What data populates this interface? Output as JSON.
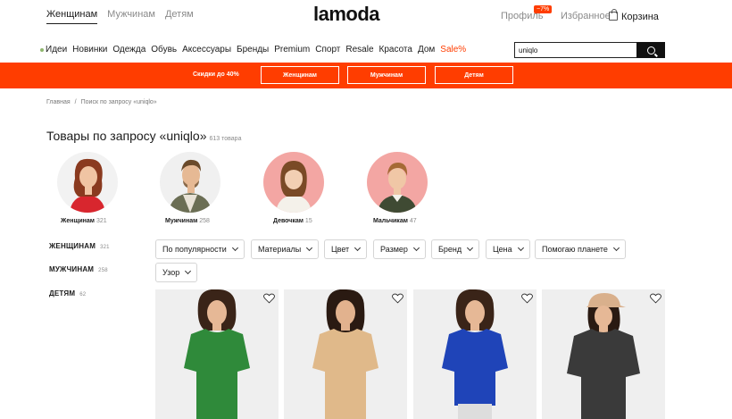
{
  "header": {
    "gender_tabs": [
      "Женщинам",
      "Мужчинам",
      "Детям"
    ],
    "logo": "lamoda",
    "profile": "Профиль",
    "profile_badge": "−7%",
    "favorites": "Избранное",
    "cart": "Корзина"
  },
  "nav": {
    "items": [
      "Идеи",
      "Новинки",
      "Одежда",
      "Обувь",
      "Аксессуары",
      "Бренды",
      "Premium",
      "Спорт",
      "Resale",
      "Красота",
      "Дом",
      "Sale%"
    ]
  },
  "search": {
    "value": "uniqlo",
    "icon": "search-icon"
  },
  "promo": {
    "text": "Скидки до 40%",
    "buttons": [
      "Женщинам",
      "Мужчинам",
      "Детям"
    ],
    "color": "#ff3d00"
  },
  "breadcrumb": [
    "Главная",
    "Поиск по запросу «uniqlo»"
  ],
  "page": {
    "title": "Товары по запросу «uniqlo»",
    "count": "613 товара"
  },
  "categories": [
    {
      "label": "Женщинам",
      "count": "321"
    },
    {
      "label": "Мужчинам",
      "count": "258"
    },
    {
      "label": "Девочкам",
      "count": "15"
    },
    {
      "label": "Мальчикам",
      "count": "47"
    }
  ],
  "side_filters": [
    {
      "label": "ЖЕНЩИНАМ",
      "count": "321"
    },
    {
      "label": "МУЖЧИНАМ",
      "count": "258"
    },
    {
      "label": "ДЕТЯМ",
      "count": "62"
    }
  ],
  "filters": [
    "По популярности",
    "Материалы",
    "Цвет",
    "Размер",
    "Бренд",
    "Цена",
    "Помогаю планете",
    "Узор"
  ],
  "products": [
    {
      "tshirt_color": "#2f8a3a",
      "icon": "heart-icon"
    },
    {
      "tshirt_color": "#e0b98a",
      "icon": "heart-icon"
    },
    {
      "tshirt_color": "#1f44b8",
      "icon": "heart-icon"
    },
    {
      "tshirt_color": "#3a3a3a",
      "icon": "heart-icon"
    }
  ]
}
